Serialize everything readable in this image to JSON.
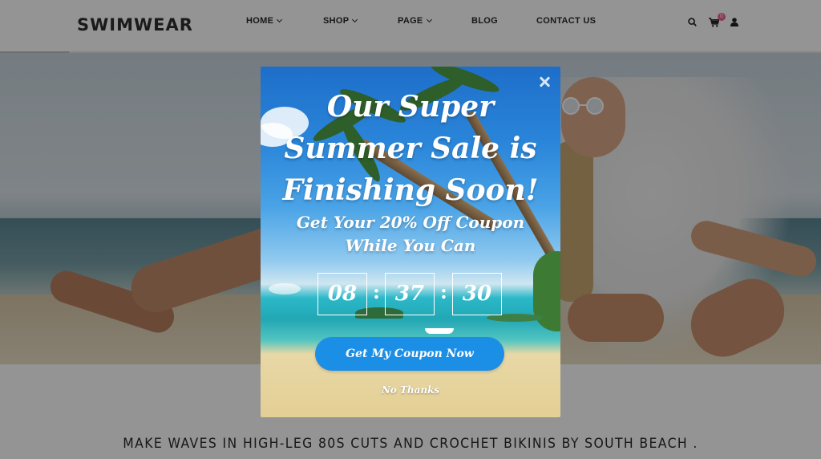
{
  "header": {
    "logo": "SWIMWEAR",
    "nav": [
      {
        "label": "HOME",
        "has_dropdown": true
      },
      {
        "label": "SHOP",
        "has_dropdown": true
      },
      {
        "label": "PAGE",
        "has_dropdown": true
      },
      {
        "label": "BLOG",
        "has_dropdown": false
      },
      {
        "label": "CONTACT US",
        "has_dropdown": false
      }
    ],
    "icons": [
      "search-icon",
      "cart-icon",
      "user-icon"
    ],
    "cart_count": "0"
  },
  "hero": {
    "tagline": "MAKE WAVES IN HIGH-LEG 80S CUTS AND CROCHET BIKINIS BY SOUTH BEACH ."
  },
  "popup": {
    "title_lines": [
      "Our Super",
      "Summer Sale is",
      "Finishing Soon!"
    ],
    "subtitle_lines": [
      "Get Your 20% Off Coupon",
      "While You Can"
    ],
    "countdown": {
      "hours": "08",
      "minutes": "37",
      "seconds": "30",
      "separator": ":"
    },
    "cta_label": "Get My Coupon Now",
    "decline_label": "No Thanks",
    "close_icon": "close-icon"
  },
  "colors": {
    "cta": "#1b8ee6",
    "badge": "#f06292",
    "overlay": "rgba(0,0,0,0.42)"
  }
}
